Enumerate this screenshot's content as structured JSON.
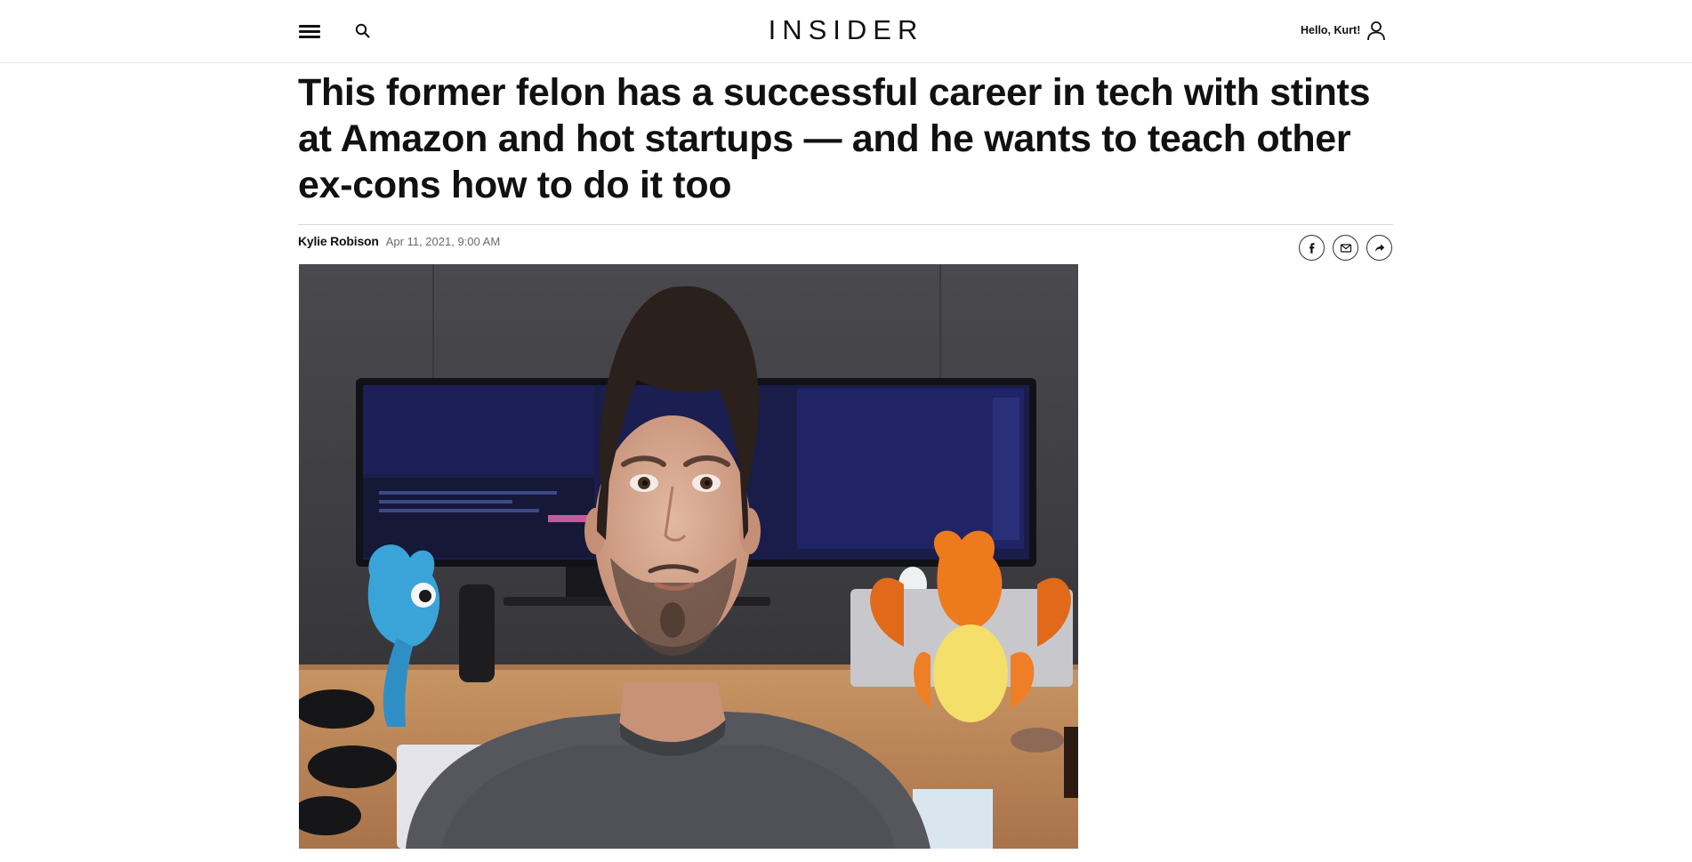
{
  "header": {
    "brand": "INSIDER",
    "greeting": "Hello, Kurt!",
    "icons": [
      "hamburger-menu-icon",
      "search-icon",
      "user-icon"
    ]
  },
  "article": {
    "headline": "This former felon has a successful career in tech with stints at Amazon and hot startups — and he wants to teach other ex-cons how to do it too",
    "author": "Kylie Robison",
    "date": "Apr 11, 2021, 9:00 AM",
    "share_icons": [
      "facebook-icon",
      "email-icon",
      "share-forward-icon"
    ]
  },
  "colors": {
    "text": "#111111",
    "muted": "#6a6a6a",
    "rule": "#d8d8d8",
    "background": "#ffffff"
  }
}
